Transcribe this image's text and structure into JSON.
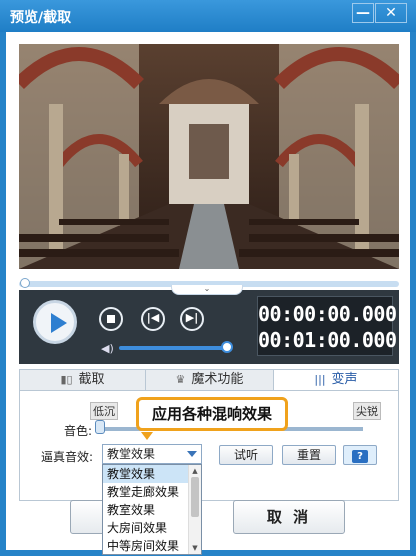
{
  "window": {
    "title": "预览/截取",
    "minimize_glyph": "—",
    "close_glyph": "✕"
  },
  "player": {
    "current_time": "00:00:00.000",
    "total_time": "00:01:00.000",
    "progress_fraction": 0.0,
    "volume_fraction": 1.0,
    "collapse_glyph": "⌄"
  },
  "tabs": [
    {
      "label": "截取",
      "icon": "film-icon",
      "icon_glyph": "▮▯",
      "active": false
    },
    {
      "label": "魔术功能",
      "icon": "magic-hat-icon",
      "icon_glyph": "🎩",
      "active": false
    },
    {
      "label": "变声",
      "icon": "sound-wave-icon",
      "icon_glyph": "|||",
      "active": true
    }
  ],
  "voice": {
    "low_label": "低沉",
    "high_label": "尖锐",
    "pitch_label": "音色:",
    "pitch_fraction": 0.0,
    "tooltip": "应用各种混响效果",
    "reverb_label": "逼真音效:",
    "reverb_selected": "教堂效果",
    "reverb_options": [
      "教堂效果",
      "教堂走廊效果",
      "教室效果",
      "大房间效果",
      "中等房间效果"
    ],
    "listen_label": "试听",
    "reset_label": "重置",
    "help_glyph": "?"
  },
  "footer": {
    "ok_label": "",
    "cancel_label": "取 消"
  },
  "colors": {
    "title_bar": "#1f7ec6",
    "accent": "#2e7fd0",
    "tooltip_border": "#f0a21c"
  }
}
